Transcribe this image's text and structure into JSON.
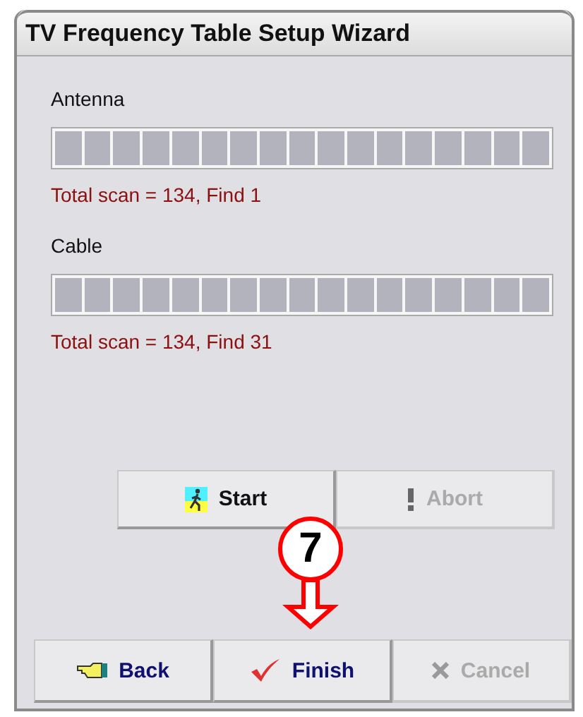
{
  "window": {
    "title": "TV Frequency Table Setup Wizard"
  },
  "scans": [
    {
      "label": "Antenna",
      "level": 1,
      "result": "Total scan =  134, Find 1"
    },
    {
      "label": "Cable",
      "level": 1,
      "result": "Total scan =  134, Find 31"
    }
  ],
  "scan_buttons": [
    {
      "kind": "start",
      "label": "Start",
      "disabled": false
    },
    {
      "kind": "abort",
      "label": "Abort",
      "disabled": true
    }
  ],
  "callout": {
    "number": "7"
  },
  "nav_buttons": [
    {
      "kind": "back",
      "label": "Back",
      "disabled": false
    },
    {
      "kind": "finish",
      "label": "Finish",
      "disabled": false
    },
    {
      "kind": "cancel",
      "label": "Cancel",
      "disabled": true
    }
  ]
}
